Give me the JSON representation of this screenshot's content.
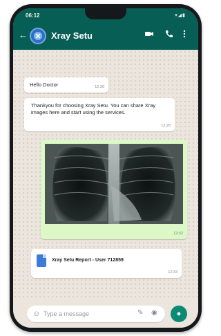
{
  "status": {
    "time": "06:12",
    "icons": "▾◢▮"
  },
  "header": {
    "back": "←",
    "title": "Xray Setu",
    "icons": {
      "video": "video-icon",
      "call": "phone-icon",
      "menu": "more-vertical-icon"
    }
  },
  "messages": [
    {
      "text": "Hello Doctor",
      "time": "12:26"
    },
    {
      "text": "Thankyou for choosing Xray Setu. You can share Xray images here and start using the services.",
      "time": "12:28"
    },
    {
      "type": "image",
      "time": "12:32"
    },
    {
      "type": "document",
      "text": "Xray Setu Report - User 712859",
      "time": "12:33"
    }
  ],
  "input": {
    "placeholder": "Type a message"
  },
  "colors": {
    "header": "#075e54",
    "outgoing": "#dcf8c6",
    "mic": "#0b8a74"
  }
}
